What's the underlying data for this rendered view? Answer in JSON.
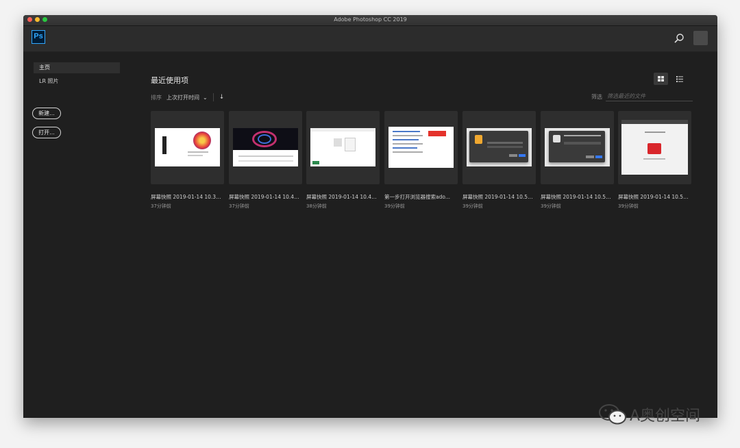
{
  "window": {
    "title": "Adobe Photoshop CC 2019"
  },
  "app": {
    "logo": "Ps"
  },
  "sidebar": {
    "items": [
      {
        "label": "主页"
      },
      {
        "label": "LR 照片"
      }
    ],
    "new_button": "新建...",
    "open_button": "打开..."
  },
  "main": {
    "title": "最近使用项",
    "sort_label": "排序",
    "sort_value": "上次打开时间",
    "filter_label": "筛选",
    "filter_placeholder": "筛选最近的文件"
  },
  "files": [
    {
      "name": "屏幕快照 2019-01-14 10.38.07...",
      "time": "37分钟前"
    },
    {
      "name": "屏幕快照 2019-01-14 10.47.44...",
      "time": "37分钟前"
    },
    {
      "name": "屏幕快照 2019-01-14 10.48.12...",
      "time": "38分钟前"
    },
    {
      "name": "第一步打开浏览器搜索ado...",
      "time": "39分钟前"
    },
    {
      "name": "屏幕快照 2019-01-14 10.55.04...",
      "time": "39分钟前"
    },
    {
      "name": "屏幕快照 2019-01-14 10.54.51...",
      "time": "39分钟前"
    },
    {
      "name": "屏幕快照 2019-01-14 10.54.39...",
      "time": "39分钟前"
    }
  ],
  "watermark": {
    "text": "A奥创空间"
  },
  "colors": {
    "ps_blue": "#31a8ff",
    "ps_bg": "#001c35",
    "window_bg": "#1f1f1f"
  }
}
